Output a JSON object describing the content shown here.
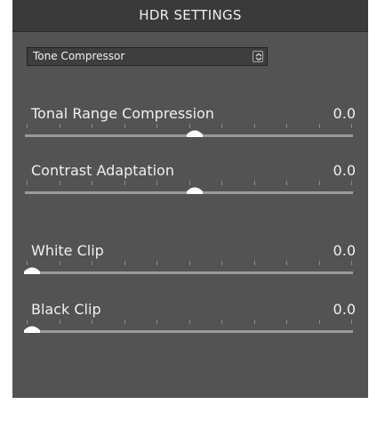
{
  "panel": {
    "title": "HDR SETTINGS",
    "mode_select": {
      "value": "Tone Compressor"
    }
  },
  "sliders": [
    {
      "label": "Tonal Range Compression",
      "value": "0.0",
      "position": 0.5
    },
    {
      "label": "Contrast Adaptation",
      "value": "0.0",
      "position": 0.5
    },
    {
      "label": "White Clip",
      "value": "0.0",
      "position": 0.0
    },
    {
      "label": "Black Clip",
      "value": "0.0",
      "position": 0.0
    }
  ],
  "colors": {
    "panel_bg": "#535353",
    "header_bg": "#3a3a3a",
    "text": "#f0f0f0",
    "thumb": "#ffffff"
  },
  "icons": {
    "select_arrow": "up-down-chevron-icon"
  }
}
